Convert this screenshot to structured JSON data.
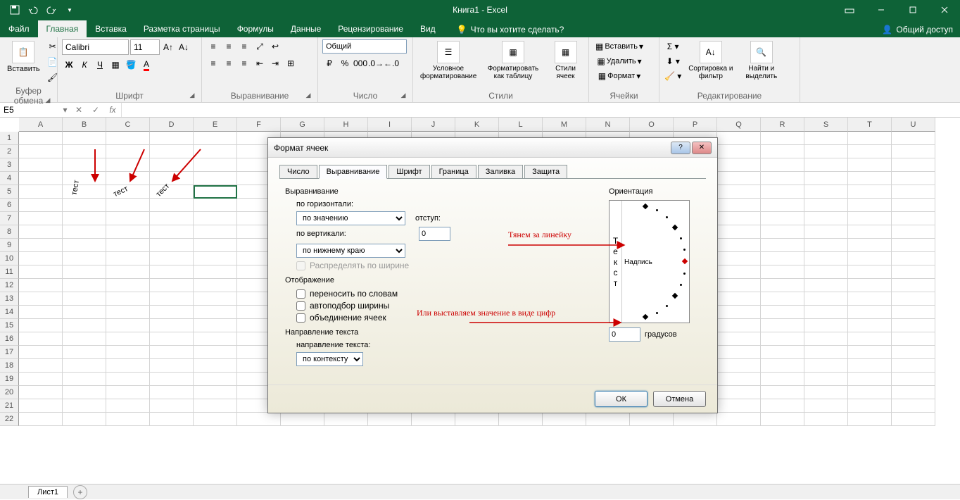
{
  "titlebar": {
    "title": "Книга1 - Excel"
  },
  "tabs": {
    "file": "Файл",
    "home": "Главная",
    "insert": "Вставка",
    "layout": "Разметка страницы",
    "formulas": "Формулы",
    "data": "Данные",
    "review": "Рецензирование",
    "view": "Вид",
    "tellme": "Что вы хотите сделать?",
    "share": "Общий доступ"
  },
  "ribbon": {
    "clipboard": {
      "paste": "Вставить",
      "label": "Буфер обмена"
    },
    "font": {
      "name": "Calibri",
      "size": "11",
      "bold": "Ж",
      "italic": "К",
      "underline": "Ч",
      "label": "Шрифт"
    },
    "align": {
      "label": "Выравнивание"
    },
    "number": {
      "format": "Общий",
      "label": "Число"
    },
    "styles": {
      "cond": "Условное форматирование",
      "table": "Форматировать как таблицу",
      "cell": "Стили ячеек",
      "label": "Стили"
    },
    "cells": {
      "insert": "Вставить",
      "delete": "Удалить",
      "format": "Формат",
      "label": "Ячейки"
    },
    "editing": {
      "sort": "Сортировка и фильтр",
      "find": "Найти и выделить",
      "label": "Редактирование"
    }
  },
  "namebox": "E5",
  "cells": {
    "b5": "тест",
    "c5": "тест",
    "d5": "тест"
  },
  "cols": [
    "A",
    "B",
    "C",
    "D",
    "E",
    "F",
    "G",
    "H",
    "I",
    "J",
    "K",
    "L",
    "M",
    "N",
    "O",
    "P",
    "Q",
    "R",
    "S",
    "T",
    "U"
  ],
  "sheetname": "Лист1",
  "dialog": {
    "title": "Формат ячеек",
    "tabs": {
      "num": "Число",
      "align": "Выравнивание",
      "font": "Шрифт",
      "border": "Граница",
      "fill": "Заливка",
      "protect": "Защита"
    },
    "align": {
      "h_sec": "Выравнивание",
      "h_lbl": "по горизонтали:",
      "h_val": "по значению",
      "indent_lbl": "отступ:",
      "indent_val": "0",
      "v_lbl": "по вертикали:",
      "v_val": "по нижнему краю",
      "distrib": "Распределять по ширине",
      "disp_sec": "Отображение",
      "wrap": "переносить по словам",
      "shrink": "автоподбор ширины",
      "merge": "объединение ячеек",
      "dir_sec": "Направление текста",
      "dir_lbl": "направление текста:",
      "dir_val": "по контексту",
      "orient_sec": "Ориентация",
      "orient_vert": "Текст",
      "orient_label": "Надпись",
      "deg_val": "0",
      "deg_lbl": "градусов"
    },
    "ok": "ОК",
    "cancel": "Отмена",
    "anno1": "Тянем за линейку",
    "anno2": "Или выставляем значение в виде цифр"
  }
}
